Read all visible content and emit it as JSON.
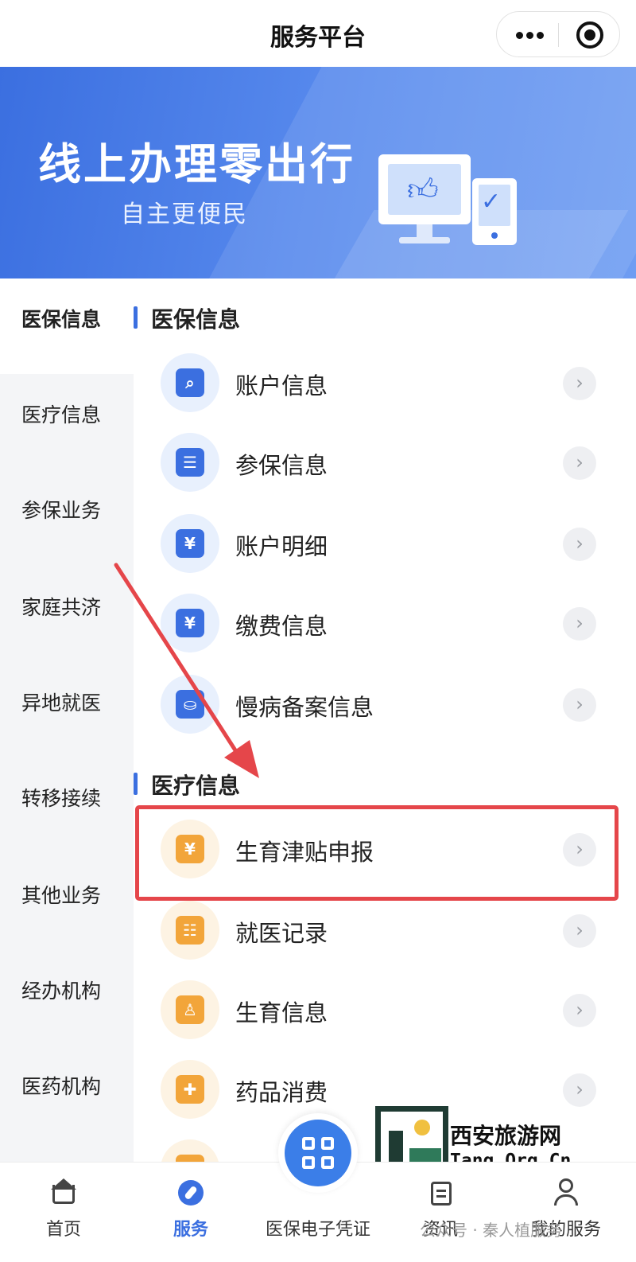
{
  "header": {
    "title": "服务平台"
  },
  "banner": {
    "headline": "线上办理零出行",
    "subtitle": "自主更便民"
  },
  "sidebar": {
    "items": [
      {
        "label": "医保信息",
        "active": true
      },
      {
        "label": "医疗信息",
        "active": false
      },
      {
        "label": "参保业务",
        "active": false
      },
      {
        "label": "家庭共济",
        "active": false
      },
      {
        "label": "异地就医",
        "active": false
      },
      {
        "label": "转移接续",
        "active": false
      },
      {
        "label": "其他业务",
        "active": false
      },
      {
        "label": "经办机构",
        "active": false
      },
      {
        "label": "医药机构",
        "active": false
      }
    ]
  },
  "sections": [
    {
      "title": "医保信息",
      "items": [
        {
          "label": "账户信息",
          "icon": "account-search-icon",
          "glyph": "⌕"
        },
        {
          "label": "参保信息",
          "icon": "insurance-card-icon",
          "glyph": "☰"
        },
        {
          "label": "账户明细",
          "icon": "yen-detail-icon",
          "glyph": "¥"
        },
        {
          "label": "缴费信息",
          "icon": "payment-icon",
          "glyph": "¥"
        },
        {
          "label": "慢病备案信息",
          "icon": "bed-patient-icon",
          "glyph": "⛀"
        }
      ]
    },
    {
      "title": "医疗信息",
      "items": [
        {
          "label": "生育津贴申报",
          "icon": "maternity-allowance-icon",
          "glyph": "¥"
        },
        {
          "label": "就医记录",
          "icon": "medical-record-icon",
          "glyph": "☷"
        },
        {
          "label": "生育信息",
          "icon": "maternity-info-icon",
          "glyph": "♙"
        },
        {
          "label": "药品消费",
          "icon": "medicine-icon",
          "glyph": "✚"
        }
      ]
    }
  ],
  "tabbar": {
    "home": "首页",
    "service": "服务",
    "voucher": "医保电子凭证",
    "news": "资讯",
    "mine": "我的服务"
  },
  "watermark": {
    "line1": "西安旅游网",
    "line2": "Tang.Org.Cn",
    "footer": "公众号 · 秦人植服务"
  },
  "colors": {
    "accent": "#3b6fe0",
    "highlight": "#e5464a",
    "orange": "#f2a53a"
  }
}
